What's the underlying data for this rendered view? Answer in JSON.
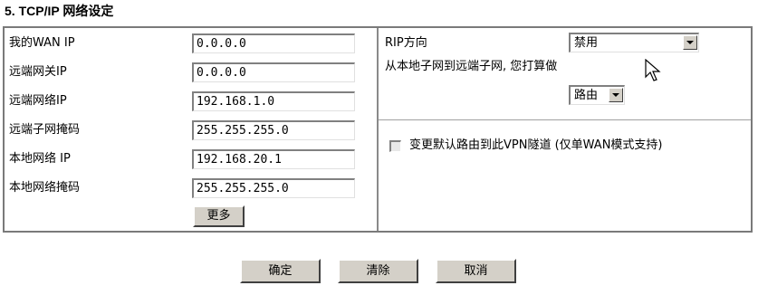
{
  "section_title": "5. TCP/IP 网络设定",
  "left": {
    "rows": [
      {
        "label": "我的WAN IP",
        "value": "0.0.0.0"
      },
      {
        "label": "远端网关IP",
        "value": "0.0.0.0"
      },
      {
        "label": "远端网络IP",
        "value": "192.168.1.0"
      },
      {
        "label": "远端子网掩码",
        "value": "255.255.255.0"
      },
      {
        "label": "本地网络 IP",
        "value": "192.168.20.1"
      },
      {
        "label": "本地网络掩码",
        "value": "255.255.255.0"
      }
    ],
    "more_button": "更多"
  },
  "right": {
    "rip_label": "RIP方向",
    "rip_value": "禁用",
    "route_text": "从本地子网到远端子网, 您打算做",
    "route_value": "路由",
    "default_route_label": "变更默认路由到此VPN隧道 (仅单WAN模式支持)"
  },
  "footer": {
    "ok": "确定",
    "clear": "清除",
    "cancel": "取消"
  },
  "icons": {
    "cursor": "mouse-pointer-icon",
    "dropdown": "chevron-down-icon"
  }
}
